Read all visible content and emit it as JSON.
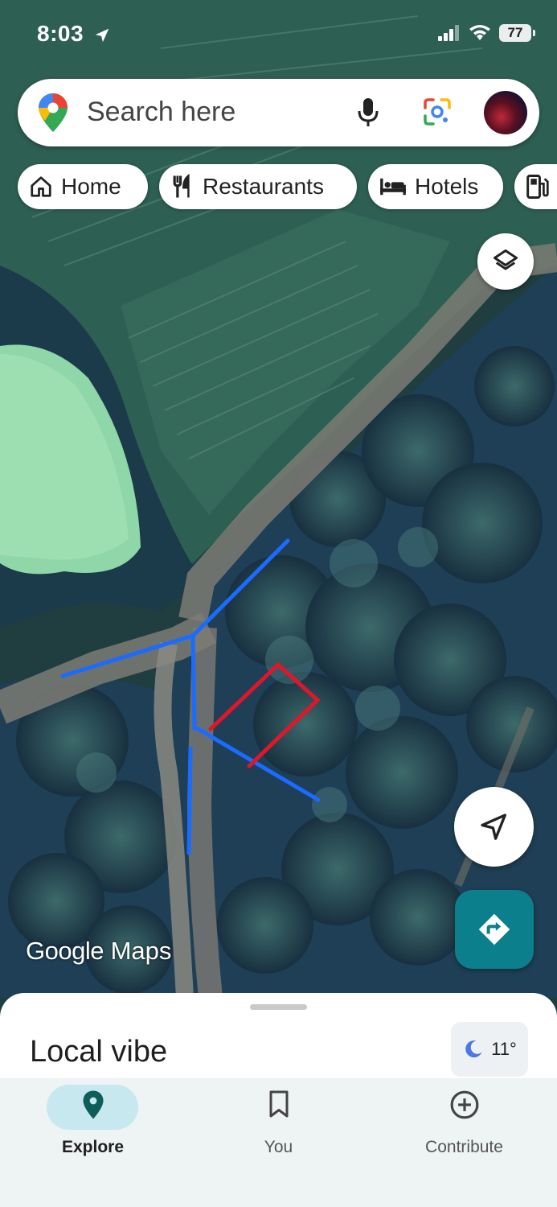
{
  "status": {
    "time": "8:03",
    "battery": "77"
  },
  "search": {
    "placeholder": "Search here"
  },
  "chips": [
    {
      "label": "Home",
      "icon": "home-icon"
    },
    {
      "label": "Restaurants",
      "icon": "restaurant-icon"
    },
    {
      "label": "Hotels",
      "icon": "hotel-icon"
    },
    {
      "label": "",
      "icon": "gas-station-icon"
    }
  ],
  "map": {
    "attribution_google": "Google",
    "attribution_maps": "Maps"
  },
  "sheet": {
    "title": "Local vibe",
    "weather_temp": "11°",
    "weather_icon": "moon-icon"
  },
  "nav": {
    "items": [
      {
        "label": "Explore",
        "icon": "explore-pin-icon",
        "active": true
      },
      {
        "label": "You",
        "icon": "bookmark-icon",
        "active": false
      },
      {
        "label": "Contribute",
        "icon": "add-circle-icon",
        "active": false
      }
    ]
  },
  "colors": {
    "accent": "#0b7f8c",
    "annotation_blue": "#1a6bff",
    "annotation_red": "#e0162a"
  }
}
